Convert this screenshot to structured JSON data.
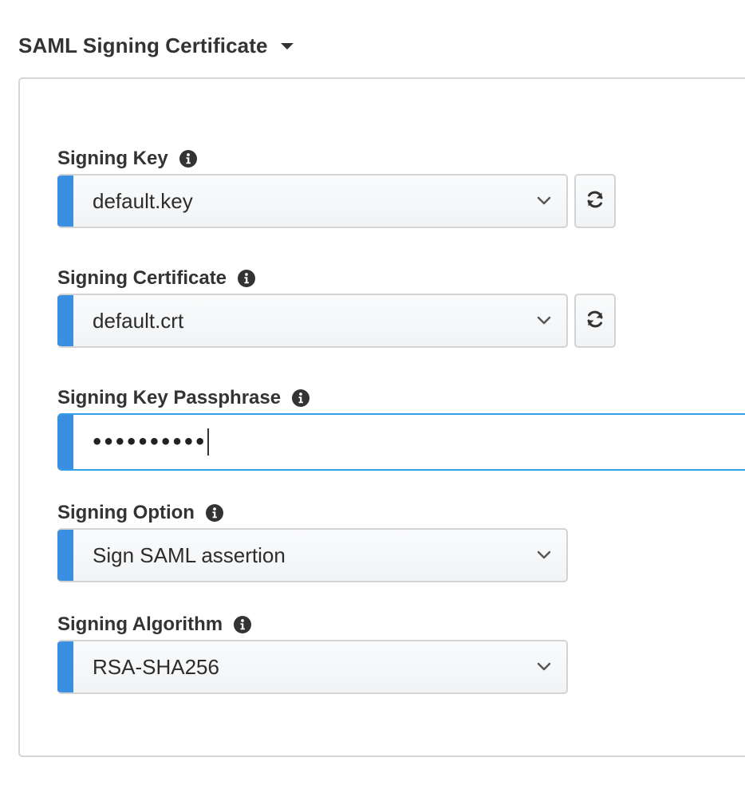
{
  "section": {
    "title": "SAML Signing Certificate",
    "toggle_icon": "caret-down-icon"
  },
  "fields": {
    "signing_key": {
      "label": "Signing Key",
      "value": "default.key",
      "info_icon": "info-circle-icon",
      "refresh_icon": "refresh-icon"
    },
    "signing_certificate": {
      "label": "Signing Certificate",
      "value": "default.crt",
      "info_icon": "info-circle-icon",
      "refresh_icon": "refresh-icon"
    },
    "signing_key_passphrase": {
      "label": "Signing Key Passphrase",
      "value": "••••••••••",
      "info_icon": "info-circle-icon"
    },
    "signing_option": {
      "label": "Signing Option",
      "value": "Sign SAML assertion",
      "info_icon": "info-circle-icon"
    },
    "signing_algorithm": {
      "label": "Signing Algorithm",
      "value": "RSA-SHA256",
      "info_icon": "info-circle-icon"
    }
  },
  "colors": {
    "required_bar": "#3a8fe0",
    "focus_border": "#2f9fe8",
    "text": "#333333",
    "panel_border": "#d6d6d6"
  }
}
